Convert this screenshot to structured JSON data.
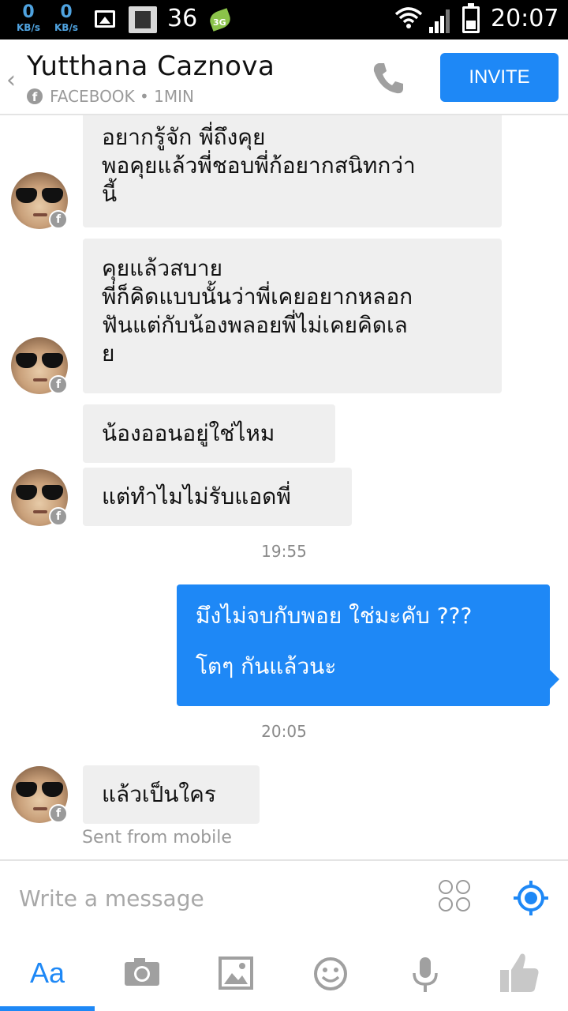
{
  "status_bar": {
    "net_down_value": "0",
    "net_down_unit": "KB/s",
    "net_up_value": "0",
    "net_up_unit": "KB/s",
    "notification_count": "36",
    "network_type": "3G",
    "time": "20:07"
  },
  "header": {
    "contact_name": "Yutthana Caznova",
    "source": "FACEBOOK • 1MIN",
    "invite_label": "INVITE"
  },
  "messages": [
    {
      "direction": "incoming",
      "lines": [
        "อยากรู้จัก พี่ถึงคุย",
        "พอคุยแล้วพี่ชอบพี่ก้อยากสนิทกว่า",
        "นี้"
      ]
    },
    {
      "direction": "incoming",
      "lines": [
        "คุยแล้วสบาย",
        "พี่ก็คิดแบบนั้นว่าพี่เคยอยากหลอก",
        "ฟันแต่กับน้องพลอยพี่ไม่เคยคิดเล",
        "ย"
      ]
    },
    {
      "direction": "incoming",
      "lines": [
        "น้องออนอยู่ใช่ไหม"
      ]
    },
    {
      "direction": "incoming",
      "lines": [
        "แต่ทำไมไม่รับแอดพี่"
      ]
    },
    {
      "direction": "outgoing",
      "lines": [
        "มึงไม่จบกับพอย ใช่มะคับ ???",
        "โตๆ กันแล้วนะ"
      ]
    },
    {
      "direction": "incoming",
      "lines": [
        "แล้วเป็นใคร"
      ]
    }
  ],
  "timestamps": [
    "19:55",
    "20:05"
  ],
  "sent_from": "Sent from mobile",
  "composer": {
    "placeholder": "Write a message"
  },
  "toolbar": {
    "text_label": "Aa",
    "items": [
      "text-icon",
      "camera-icon",
      "gallery-icon",
      "emoji-icon",
      "microphone-icon",
      "like-icon"
    ]
  },
  "colors": {
    "accent": "#1e88f6",
    "incoming_bubble": "#efefef",
    "muted": "#9a9a9a"
  }
}
